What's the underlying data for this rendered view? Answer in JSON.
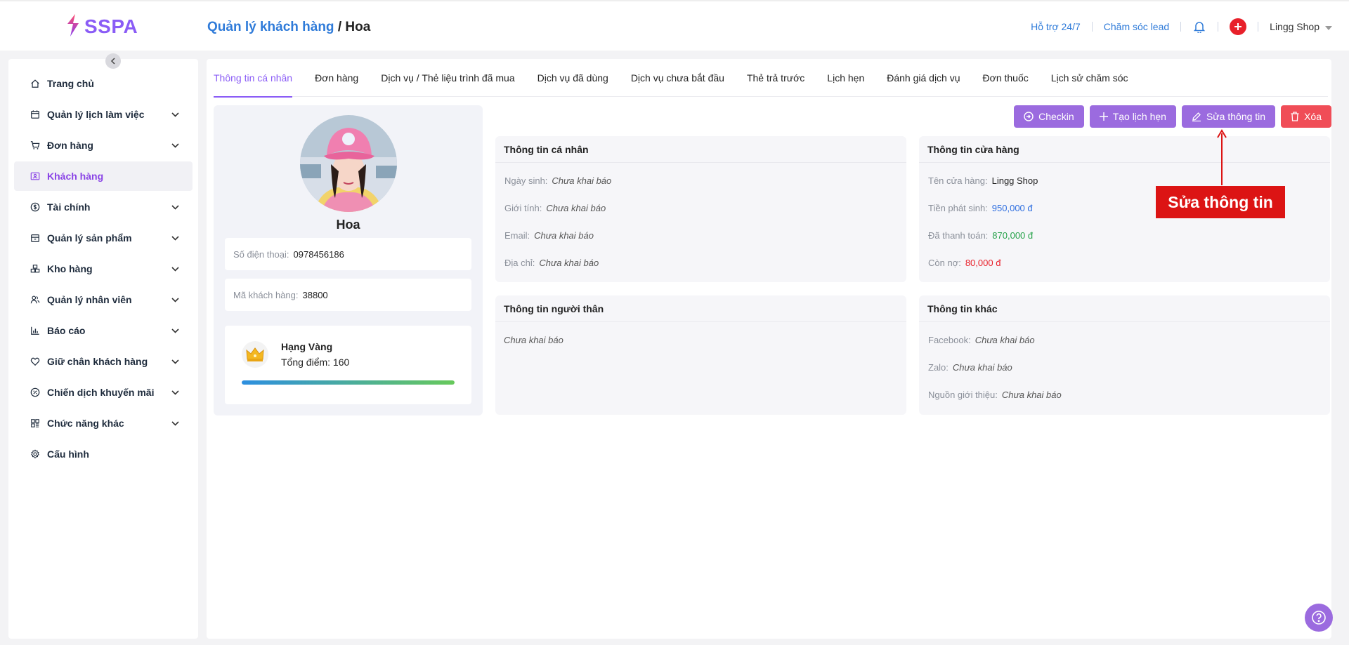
{
  "app": {
    "logo_text": "SSPA"
  },
  "breadcrumb": {
    "parent": "Quản lý khách hàng",
    "separator": "/",
    "current": "Hoa"
  },
  "header": {
    "support": "Hỗ trợ 24/7",
    "lead_care": "Chăm sóc lead",
    "user_name": "Lingg Shop"
  },
  "sidebar": {
    "items": [
      {
        "label": "Trang chủ",
        "icon": "home-icon",
        "expandable": false
      },
      {
        "label": "Quản lý lịch làm việc",
        "icon": "calendar-icon",
        "expandable": true
      },
      {
        "label": "Đơn hàng",
        "icon": "cart-icon",
        "expandable": true
      },
      {
        "label": "Khách hàng",
        "icon": "contact-card-icon",
        "expandable": false,
        "active": true
      },
      {
        "label": "Tài chính",
        "icon": "dollar-circle-icon",
        "expandable": true
      },
      {
        "label": "Quản lý sản phẩm",
        "icon": "box-icon",
        "expandable": true
      },
      {
        "label": "Kho hàng",
        "icon": "boxes-icon",
        "expandable": true
      },
      {
        "label": "Quản lý nhân viên",
        "icon": "users-icon",
        "expandable": true
      },
      {
        "label": "Báo cáo",
        "icon": "bar-chart-icon",
        "expandable": true
      },
      {
        "label": "Giữ chân khách hàng",
        "icon": "heart-icon",
        "expandable": true
      },
      {
        "label": "Chiến dịch khuyến mãi",
        "icon": "discount-icon",
        "expandable": true
      },
      {
        "label": "Chức năng khác",
        "icon": "grid-icon",
        "expandable": true
      },
      {
        "label": "Cấu hình",
        "icon": "gear-icon",
        "expandable": false
      }
    ]
  },
  "tabs": [
    {
      "label": "Thông tin cá nhân",
      "active": true
    },
    {
      "label": "Đơn hàng"
    },
    {
      "label": "Dịch vụ / Thẻ liệu trình đã mua"
    },
    {
      "label": "Dịch vụ đã dùng"
    },
    {
      "label": "Dịch vụ chưa bắt đầu"
    },
    {
      "label": "Thẻ trả trước"
    },
    {
      "label": "Lịch hẹn"
    },
    {
      "label": "Đánh giá dịch vụ"
    },
    {
      "label": "Đơn thuốc"
    },
    {
      "label": "Lịch sử chăm sóc"
    }
  ],
  "profile": {
    "name": "Hoa",
    "phone_label": "Số điện thoại:",
    "phone": "0978456186",
    "code_label": "Mã khách hàng:",
    "code": "38800",
    "rank": "Hạng Vàng",
    "points": "Tổng điểm: 160",
    "progress": 1.0
  },
  "actions": {
    "checkin": "Checkin",
    "appointment": "Tạo lịch hẹn",
    "edit": "Sửa thông tin",
    "delete": "Xóa"
  },
  "personal_info": {
    "title": "Thông tin cá nhân",
    "rows": [
      {
        "label": "Ngày sinh:",
        "value": "Chưa khai báo"
      },
      {
        "label": "Giới tính:",
        "value": "Chưa khai báo"
      },
      {
        "label": "Email:",
        "value": "Chưa khai báo"
      },
      {
        "label": "Địa chỉ:",
        "value": "Chưa khai báo"
      }
    ]
  },
  "store_info": {
    "title": "Thông tin cửa hàng",
    "store_label": "Tên cửa hàng:",
    "store": "Lingg Shop",
    "incurred_label": "Tiền phát sinh:",
    "incurred": "950,000 đ",
    "paid_label": "Đã thanh toán:",
    "paid": "870,000 đ",
    "debt_label": "Còn nợ:",
    "debt": "80,000 đ"
  },
  "relatives": {
    "title": "Thông tin người thân",
    "empty": "Chưa khai báo"
  },
  "other_info": {
    "title": "Thông tin khác",
    "rows": [
      {
        "label": "Facebook:",
        "value": "Chưa khai báo"
      },
      {
        "label": "Zalo:",
        "value": "Chưa khai báo"
      },
      {
        "label": "Nguồn giới thiệu:",
        "value": "Chưa khai báo"
      }
    ]
  },
  "annotation": {
    "callout": "Sửa thông tin"
  },
  "colors": {
    "primary": "#8a5cf6",
    "button_purple": "#9b6bdf",
    "danger": "#f04d57",
    "link": "#2f7bd9",
    "callout": "#dc1414"
  }
}
